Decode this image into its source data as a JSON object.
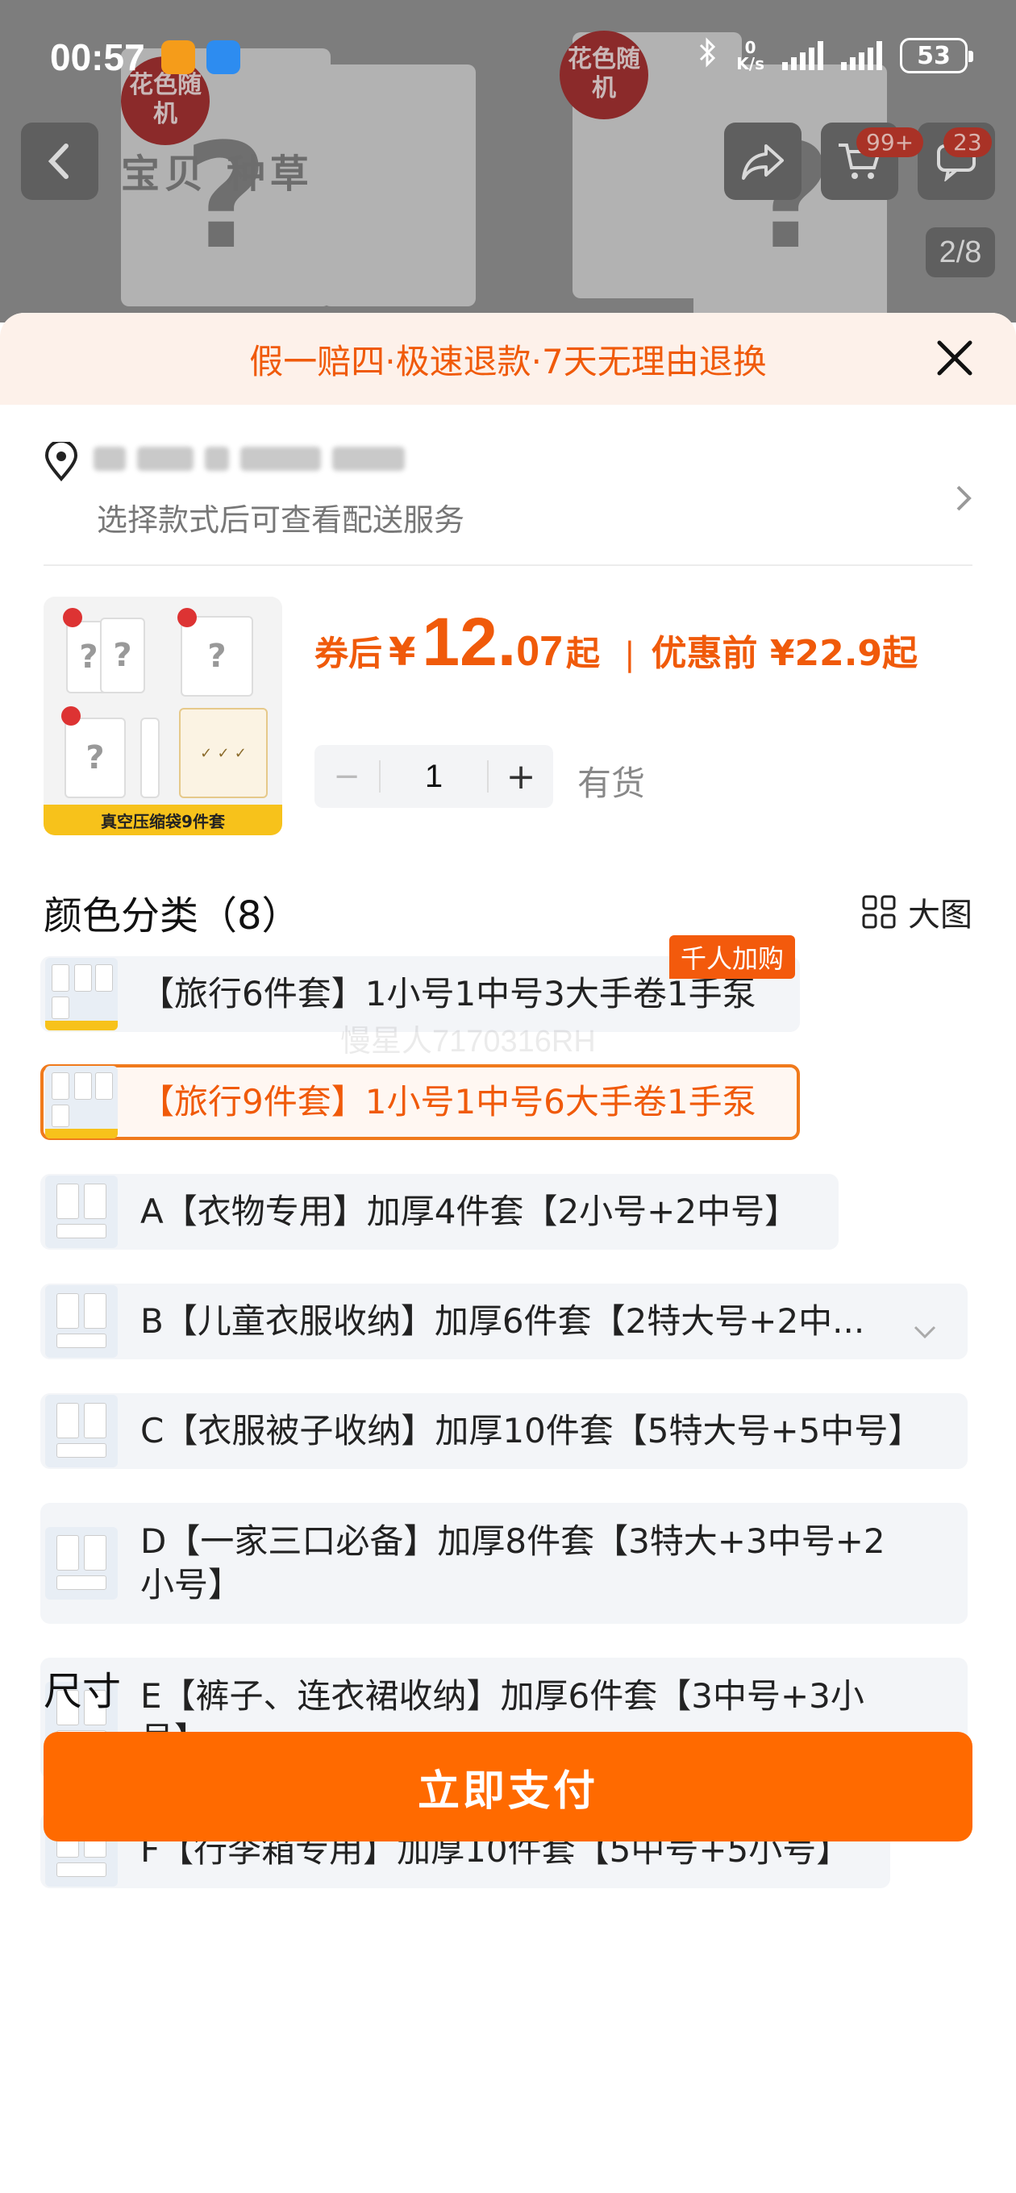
{
  "status_bar": {
    "time": "00:57",
    "net_speed_value": "0",
    "net_speed_unit": "K/s",
    "battery": "53"
  },
  "header": {
    "tabs": "宝贝  种草",
    "cart_badge": "99+",
    "msg_badge": "23",
    "page_indicator": "2/8",
    "bg_badge_text": "花色随机",
    "icons": [
      "back-icon",
      "share-icon",
      "cart-icon",
      "message-icon"
    ]
  },
  "guarantee": {
    "text": "假一赔四·极速退款·7天无理由退换"
  },
  "address": {
    "subtitle": "选择款式后可查看配送服务"
  },
  "product": {
    "price_prefix": "券后",
    "currency": "¥",
    "price_int": "12.",
    "price_dec": "07",
    "price_suffix": "起",
    "separator": "|",
    "before_price": "优惠前 ¥22.9起",
    "thumb_banner": "真空压缩袋9件套",
    "quantity": "1",
    "minus": "−",
    "plus": "+",
    "stock": "有货"
  },
  "color_section": {
    "title": "颜色分类（8）",
    "big_image_label": "大图",
    "hot_tag": "千人加购",
    "watermark": "慢星人7170316RH",
    "options": [
      {
        "label": "【旅行6件套】1小号1中号3大手卷1手泵"
      },
      {
        "label": "【旅行9件套】1小号1中号6大手卷1手泵",
        "selected": true
      },
      {
        "label": "A【衣物专用】加厚4件套【2小号+2中号】"
      },
      {
        "label": "B【儿童衣服收纳】加厚6件套【2特大号+2中..."
      },
      {
        "label": "C【衣服被子收纳】加厚10件套【5特大号+5中号】"
      },
      {
        "label": "D【一家三口必备】加厚8件套【3特大+3中号+2小号】"
      },
      {
        "label": "E【裤子、连衣裙收纳】加厚6件套【3中号+3小号】"
      },
      {
        "label": "F【行李箱专用】加厚10件套【5中号+5小号】"
      }
    ]
  },
  "size_section": {
    "title": "尺寸"
  },
  "pay_button": {
    "label": "立即支付"
  },
  "colors": {
    "accent": "#ff6a00",
    "price": "#f05a0a",
    "guarantee_bg": "#fdf1ea"
  }
}
